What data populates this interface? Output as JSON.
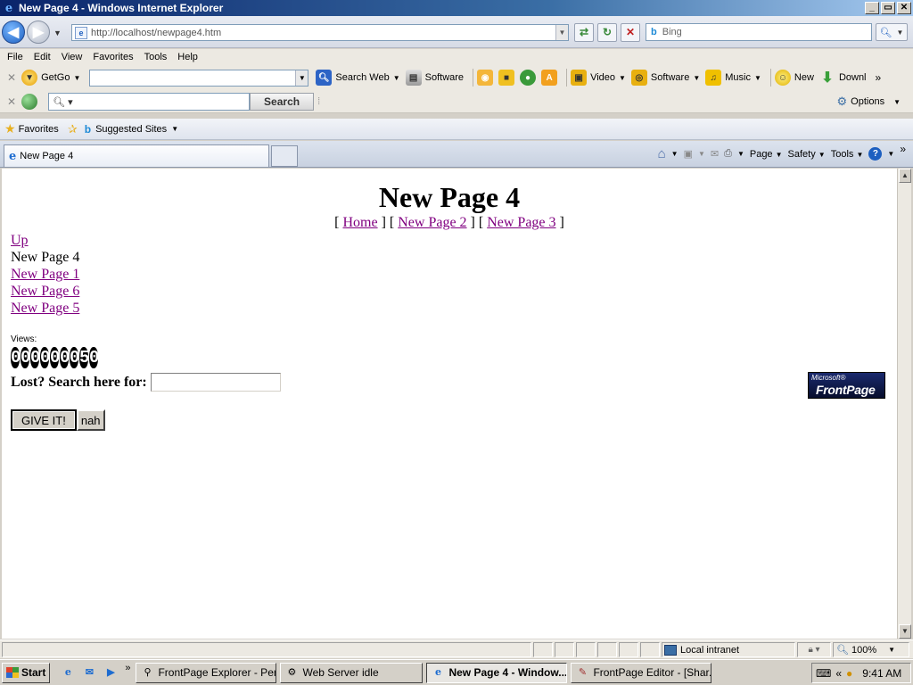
{
  "window": {
    "title": "New Page 4 - Windows Internet Explorer",
    "buttons": [
      "_",
      "▭",
      "✕"
    ]
  },
  "address_bar": {
    "url": "http://localhost/newpage4.htm",
    "search_placeholder": "Bing"
  },
  "menu": [
    "File",
    "Edit",
    "View",
    "Favorites",
    "Tools",
    "Help"
  ],
  "toolbar1": {
    "getgo": "GetGo",
    "search_web": "Search Web",
    "software": "Software",
    "video": "Video",
    "software2": "Software",
    "music": "Music",
    "new": "New",
    "download": "Downl"
  },
  "toolbar2": {
    "search_button": "Search",
    "options": "Options"
  },
  "favorites_bar": {
    "favorites": "Favorites",
    "suggested_sites": "Suggested Sites"
  },
  "tab": {
    "title": "New Page 4"
  },
  "command_bar": {
    "page": "Page",
    "safety": "Safety",
    "tools": "Tools"
  },
  "page": {
    "title": "New Page 4",
    "crumbs": {
      "home": "Home",
      "page2": "New Page 2",
      "page3": "New Page 3"
    },
    "nav": {
      "up": "Up",
      "current": "New Page 4",
      "page1": "New Page 1",
      "page6": "New Page 6",
      "page5": "New Page 5"
    },
    "views_label": "Views:",
    "counter_digits": [
      "0",
      "0",
      "0",
      "0",
      "0",
      "0",
      "0",
      "5",
      "0"
    ],
    "search_label": "Lost? Search here for:",
    "search_value": "",
    "submit_label": "GIVE IT!",
    "reset_label": "nah",
    "badge": {
      "microsoft": "Microsoft®",
      "frontpage": "FrontPage"
    }
  },
  "status_bar": {
    "zone": "Local intranet",
    "zoom": "100%"
  },
  "taskbar": {
    "start": "Start",
    "items": [
      {
        "label": "FrontPage Explorer - Per...",
        "active": false
      },
      {
        "label": "Web Server idle",
        "active": false
      },
      {
        "label": "New Page 4 - Window...",
        "active": true
      },
      {
        "label": "FrontPage Editor - [Shar...",
        "active": false
      }
    ],
    "clock": "9:41 AM"
  },
  "colors": {
    "link_visited": "#800080",
    "titlebar_start": "#0a246a",
    "titlebar_end": "#a6caf0"
  }
}
